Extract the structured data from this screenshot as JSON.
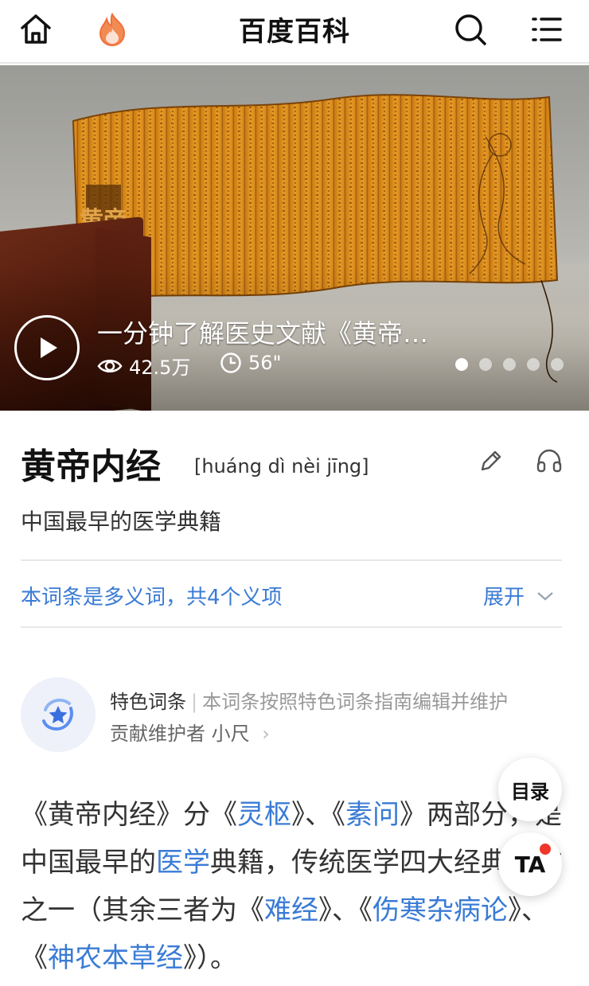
{
  "header": {
    "title": "百度百科",
    "home_icon": "home-icon",
    "hot_icon": "flame-icon",
    "search_icon": "search-icon",
    "menu_icon": "menu-icon",
    "accent_color": "#f0703a"
  },
  "banner": {
    "video_title": "一分钟了解医史文献《黄帝…",
    "views": "42.5万",
    "duration": "56\"",
    "slide_count": 5,
    "active_slide": 1,
    "seal_text": "黄帝"
  },
  "entry": {
    "title": "黄帝内经",
    "pinyin": "[huáng dì nèi jīng]",
    "subtitle": "中国最早的医学典籍",
    "edit_icon": "pencil-icon",
    "audio_icon": "headphones-icon"
  },
  "polysemy": {
    "text": "本词条是多义词，共4个义项",
    "expand_label": "展开"
  },
  "feature": {
    "label": "特色词条",
    "description": "本词条按照特色词条指南编辑并维护",
    "maintainer": "贡献维护者 小尺",
    "icon": "star-badge-icon"
  },
  "body": {
    "p1_a": "《黄帝内经》分《",
    "link_lingshu": "灵枢",
    "p1_b": "》、《",
    "link_suwen": "素问",
    "p1_c": "》两部分，是中国最早的",
    "link_yixue": "医学",
    "p1_d": "典籍，传统医学四大经典著作之一（其余三者为《",
    "link_nanjing": "难经",
    "p1_e": "》、《",
    "link_shanghan": "伤寒杂病论",
    "p1_f": "》、《",
    "link_shennong": "神农本草经",
    "p1_g": "》）。"
  },
  "fab": {
    "toc_label": "目录",
    "ta_label": "TA"
  },
  "colors": {
    "link": "#3a7bd5",
    "notify": "#f0362b"
  }
}
